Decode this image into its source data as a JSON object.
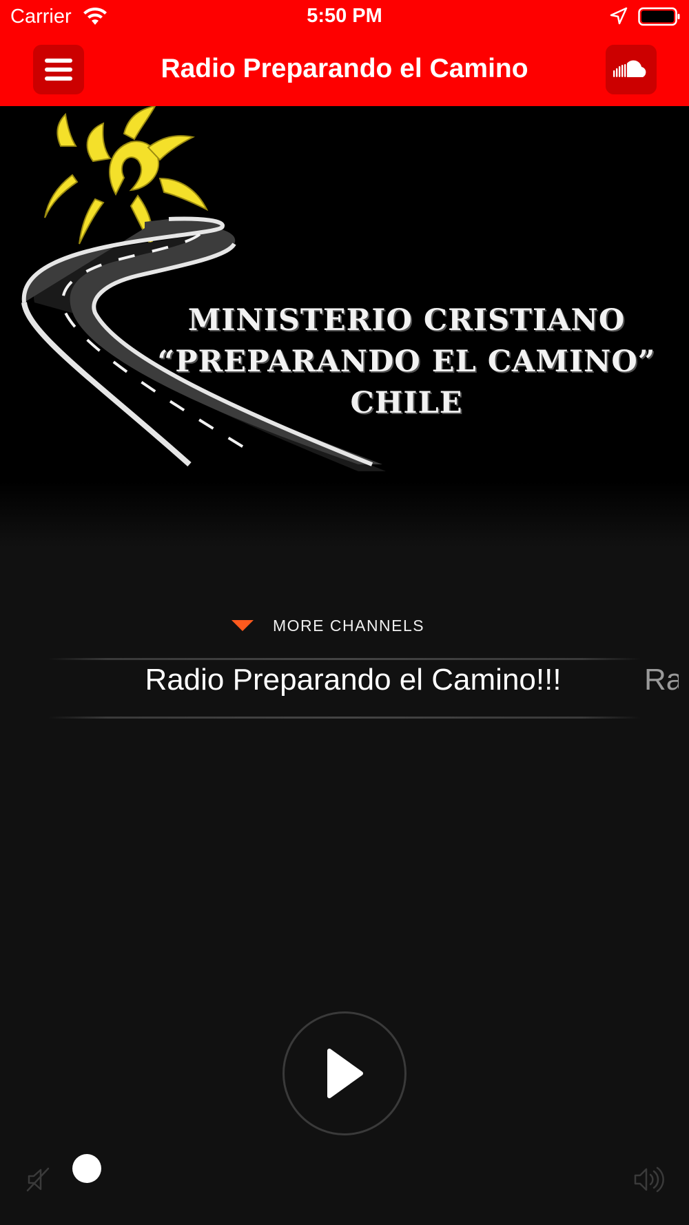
{
  "status_bar": {
    "carrier": "Carrier",
    "time": "5:50 PM",
    "icons": [
      "wifi-icon",
      "location-arrow-icon",
      "battery-icon"
    ]
  },
  "header": {
    "title": "Radio Preparando el Camino",
    "left_button_icon": "hamburger-menu-icon",
    "right_button_icon": "soundcloud-icon"
  },
  "artwork": {
    "line1": "MINISTERIO CRISTIANO",
    "line2": "“PREPARANDO EL CAMINO”",
    "line3": "CHILE"
  },
  "channels": {
    "more_label": "MORE CHANNELS",
    "current": "Radio Preparando el Camino!!!",
    "next_partial": "Ra"
  },
  "player": {
    "play_icon": "play-icon",
    "mute_icon": "mute-icon",
    "volume_icon": "speaker-icon",
    "volume_level": 0.0
  },
  "colors": {
    "header": "#fe0000",
    "header_button": "#cc0000",
    "background": "#111111",
    "accent": "#ff5a1e"
  }
}
